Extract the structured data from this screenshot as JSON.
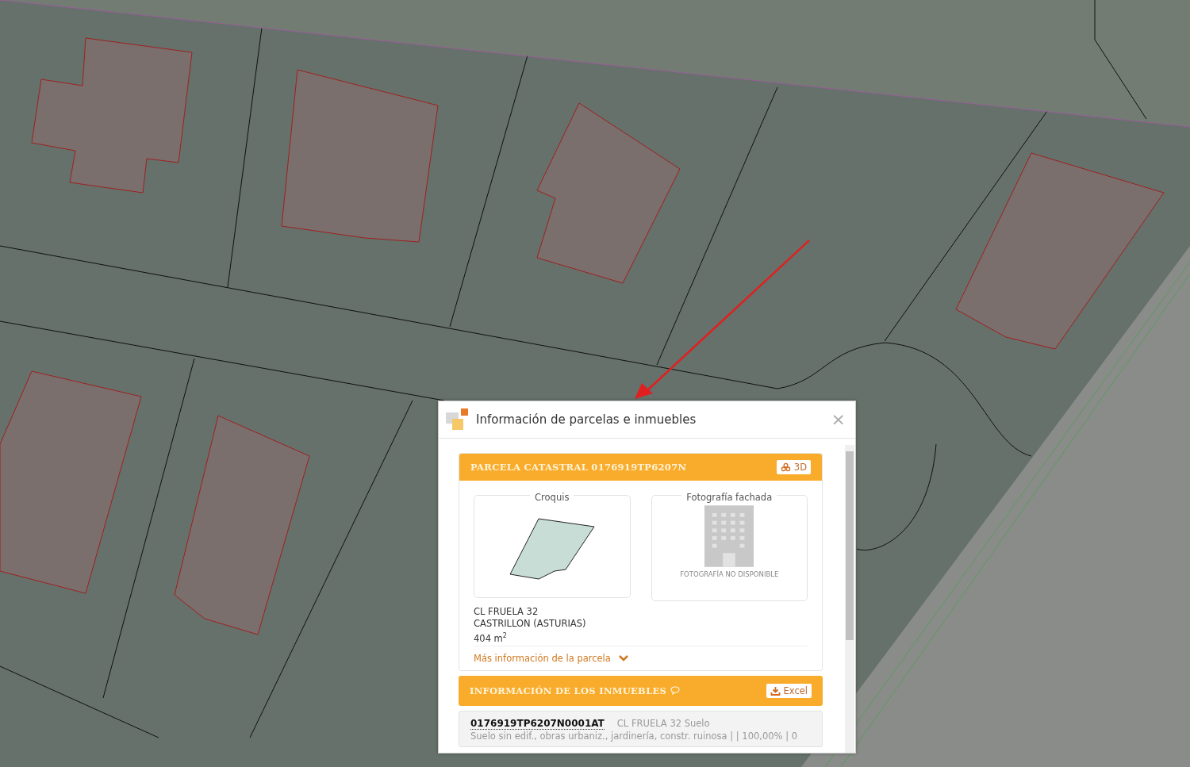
{
  "dialog": {
    "title": "Información de parcelas e inmuebles",
    "close": "×",
    "parcel": {
      "heading": "PARCELA CATASTRAL 0176919TP6207N",
      "button": "3D",
      "sketch_label": "Croquis",
      "photo_label": "Fotografía fachada",
      "photo_unavailable": "FOTOGRAFÍA NO DISPONIBLE",
      "address_lines": [
        "CL FRUELA 32",
        "CASTRILLON (ASTURIAS)",
        "404 m$^{2}$"
      ],
      "more_link": "Más información de la parcela",
      "expanded": false
    },
    "properties": {
      "heading": "INFORMACIÓN DE LOS INMUEBLES",
      "button": "Excel",
      "items": [
        {
          "reference": "0176919TP6207N0001AT",
          "address": "CL FRUELA 32 Suelo",
          "detail": "Suelo sin edif., obras urbaniz., jardinería, constr. ruinosa | | 100,00% | 0"
        }
      ]
    }
  }
}
